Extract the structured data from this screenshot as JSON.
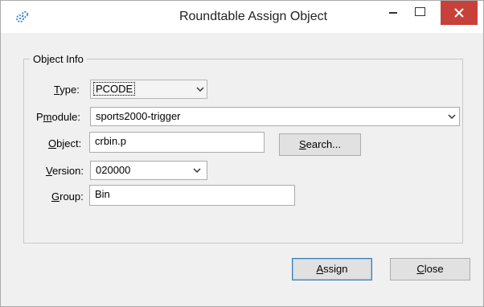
{
  "window": {
    "title": "Roundtable Assign Object"
  },
  "group": {
    "legend": "Object Info"
  },
  "form": {
    "type": {
      "label": "Type:",
      "underline_char": "T",
      "rest": "ype:",
      "value": "PCODE"
    },
    "pmodule": {
      "label": "Pmodule:",
      "prefix": "P",
      "underline_char": "m",
      "rest": "odule:",
      "value": "sports2000-trigger"
    },
    "object": {
      "label": "Object:",
      "underline_char": "O",
      "rest": "bject:",
      "value": "crbin.p"
    },
    "version": {
      "label": "Version:",
      "underline_char": "V",
      "rest": "ersion:",
      "value": "020000"
    },
    "group": {
      "label": "Group:",
      "underline_char": "G",
      "rest": "roup:",
      "value": "Bin"
    }
  },
  "buttons": {
    "search": {
      "underline_char": "S",
      "rest": "earch..."
    },
    "assign": {
      "underline_char": "A",
      "rest": "ssign"
    },
    "close": {
      "underline_char": "C",
      "rest": "lose"
    }
  },
  "icons": {
    "app": "cogs-icon",
    "minimize": "minimize-icon",
    "maximize": "maximize-icon",
    "close": "close-icon",
    "dropdown": "chevron-down-icon"
  },
  "colors": {
    "close_button": "#c7403a",
    "window_bg": "#f0f0f0",
    "titlebar_bg": "#ffffff"
  }
}
